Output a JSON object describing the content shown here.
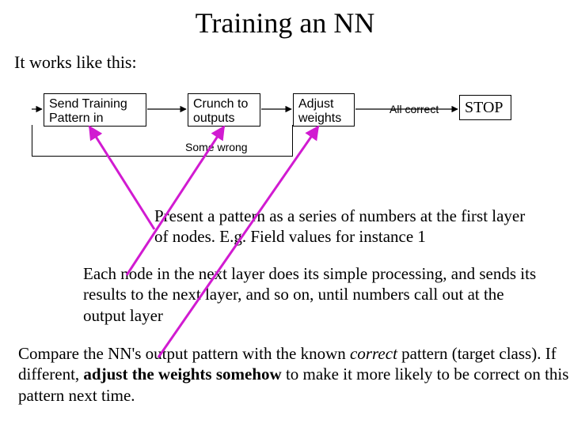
{
  "title": "Training an NN",
  "intro": "It works like this:",
  "flow": {
    "box1": "Send Training Pattern in",
    "box2": "Crunch to outputs",
    "box3": "Adjust weights",
    "all_correct": "All correct",
    "stop": "STOP",
    "some_wrong": "Some wrong"
  },
  "para1": "Present a pattern as a series of numbers at the first layer of nodes. E.g. Field values for instance 1",
  "para2": "Each node in the next layer does its simple processing, and sends its results to the next layer, and so on, until numbers call out at the output layer",
  "para3_a": "Compare the NN's output pattern with the known ",
  "para3_b": "correct",
  "para3_c": " pattern (target class). If different, ",
  "para3_d": "adjust the weights somehow",
  "para3_e": " to make it more likely to be correct on this pattern next time."
}
